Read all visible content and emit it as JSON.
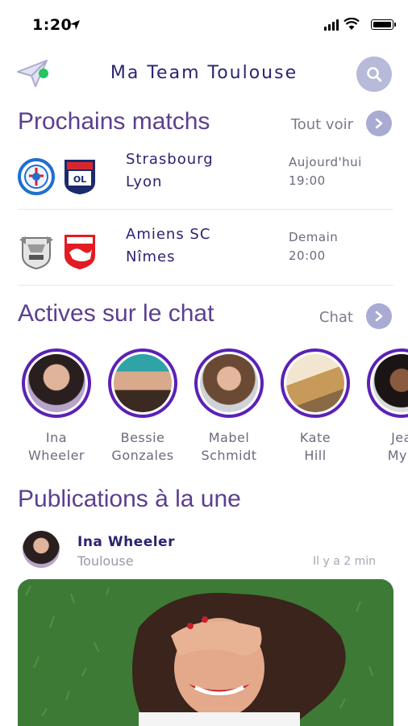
{
  "status_bar": {
    "time": "1:20"
  },
  "header": {
    "title": "Ma Team Toulouse"
  },
  "matches_section": {
    "title": "Prochains matchs",
    "link_label": "Tout voir",
    "matches": [
      {
        "home": "Strasbourg",
        "away": "Lyon",
        "day": "Aujourd'hui",
        "time": "19:00",
        "home_logo": "strasbourg-crest",
        "away_logo": "lyon-crest"
      },
      {
        "home": "Amiens SC",
        "away": "Nîmes",
        "day": "Demain",
        "time": "20:00",
        "home_logo": "amiens-crest",
        "away_logo": "nimes-crest"
      }
    ]
  },
  "chat_section": {
    "title": "Actives sur le chat",
    "link_label": "Chat",
    "members": [
      {
        "first": "Ina",
        "last": "Wheeler"
      },
      {
        "first": "Bessie",
        "last": "Gonzales"
      },
      {
        "first": "Mabel",
        "last": "Schmidt"
      },
      {
        "first": "Kate",
        "last": "Hill"
      },
      {
        "first": "Jea",
        "last": "Mye"
      }
    ]
  },
  "publications_section": {
    "title": "Publications à la une",
    "post": {
      "author": "Ina Wheeler",
      "city": "Toulouse",
      "time": "Il y a 2 min"
    }
  },
  "colors": {
    "accent": "#5b21b6",
    "title": "#2b2470",
    "online": "#22c55e",
    "button": "#b8bad9"
  }
}
